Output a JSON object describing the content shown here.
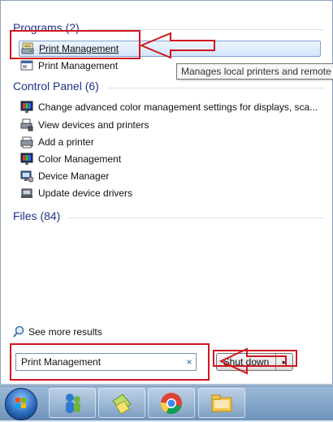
{
  "groups": {
    "programs": {
      "header": "Programs (2)",
      "items": [
        {
          "label": "Print Management",
          "icon": "print-management-icon",
          "selected": true
        },
        {
          "label": "Print Management",
          "icon": "print-management-icon",
          "selected": false
        }
      ]
    },
    "control_panel": {
      "header": "Control Panel (6)",
      "items": [
        {
          "label": "Change advanced color management settings for displays, sca...",
          "icon": "monitor-color-icon"
        },
        {
          "label": "View devices and printers",
          "icon": "devices-printers-icon"
        },
        {
          "label": "Add a printer",
          "icon": "add-printer-icon"
        },
        {
          "label": "Color Management",
          "icon": "monitor-color-icon"
        },
        {
          "label": "Device Manager",
          "icon": "device-manager-icon"
        },
        {
          "label": "Update device drivers",
          "icon": "device-driver-icon"
        }
      ]
    },
    "files": {
      "header": "Files (84)"
    }
  },
  "tooltip": "Manages local printers and remote",
  "see_more": "See more results",
  "search": {
    "value": "Print Management",
    "clear": "×"
  },
  "shutdown": {
    "label": "Shut down",
    "arrow": "▸"
  },
  "taskbar": {
    "items": [
      "start-orb",
      "people-app-icon",
      "notes-app-icon",
      "chrome-icon",
      "file-explorer-icon"
    ]
  },
  "colors": {
    "accent": "#1e3287",
    "highlight_border": "#d0161f"
  }
}
